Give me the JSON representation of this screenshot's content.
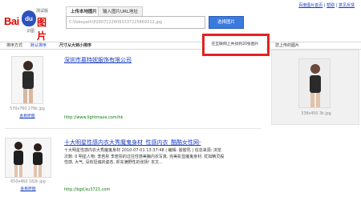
{
  "logo": {
    "bai": "Bai",
    "du": "du",
    "pic": "图片",
    "beta": "测试版",
    "sub": "识图"
  },
  "header_links": [
    "百度图片首页",
    "帮助",
    "意见反馈"
  ],
  "tabs": [
    "上传本地图片",
    "输入图片URL地址"
  ],
  "upload": {
    "value": "C:\\fakepath\\P20071226093337225869312.jpg",
    "button": "选择图片"
  },
  "sort_bar": {
    "label": "排序方式",
    "options": [
      "默认排序",
      "尺寸从大到小排序"
    ]
  },
  "result_count_text": "在互联网上共找到20张图片",
  "side_panel": {
    "title": "您上传的图片",
    "caption": "338x450 3k jpg"
  },
  "results": [
    {
      "title": "深圳市慕特妮服饰有限公司",
      "url": "http://www.lightmase.com/hk",
      "size": "570x760 278k jpg",
      "similar": "查看原图",
      "desc": ""
    },
    {
      "title": "十大明星性感内衣大秀魔鬼身材_性感内衣_酷酷女性网-",
      "url": "http://bgd.ku3721.com",
      "size": "650x460 182k jpg",
      "similar": "查看原图",
      "date": "2010-07-01 13:37:48",
      "desc": "十大明星性感内衣大秀魔鬼身材 2010-07-01 13:37:48 | 编辑: 胶胶乳 | 信息来源: 浏览次数: 0 明星人物: 李若彤 李若彤的过往性感美胸内衣写真, 完美彰显魔鬼身材, 犹如精灵般性感, 大气, 没有坦诚的姿态, 却充满野性的张扬! 本文..."
    }
  ],
  "colors": {
    "accent": "#1a3dc1",
    "highlight": "#e32222",
    "button": "#3a7adf",
    "url": "#0a7a0a"
  }
}
